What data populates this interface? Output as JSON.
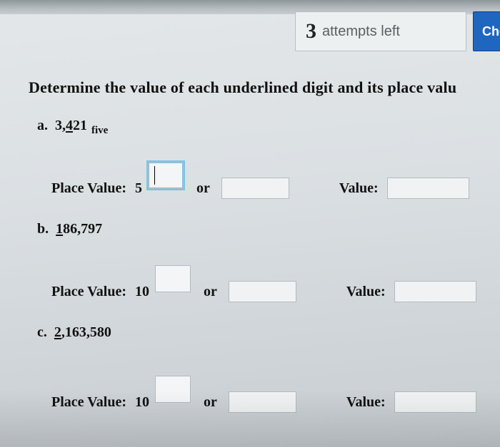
{
  "header": {
    "attempts_number": "3",
    "attempts_text": "attempts left",
    "check_label": "Check my"
  },
  "instruction": "Determine the value of each underlined digit and its place valu",
  "labels": {
    "place_value": "Place Value:",
    "or": "or",
    "value": "Value:"
  },
  "questions": {
    "a": {
      "letter": "a.",
      "pre": "3,",
      "underlined": "4",
      "post": "21",
      "subscript": "five",
      "pv_base": "5"
    },
    "b": {
      "letter": "b.",
      "pre": "",
      "underlined": "1",
      "post": "86,797",
      "subscript": "",
      "pv_base": "10"
    },
    "c": {
      "letter": "c.",
      "pre": "",
      "underlined": "2",
      "post": ",163,580",
      "subscript": "",
      "pv_base": "10"
    }
  }
}
